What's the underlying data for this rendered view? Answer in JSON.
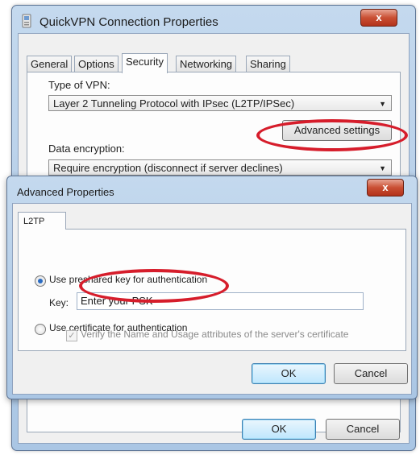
{
  "outer": {
    "title": "QuickVPN Connection Properties",
    "close_glyph": "x",
    "tabs": [
      "General",
      "Options",
      "Security",
      "Networking",
      "Sharing"
    ],
    "active_tab": "Security",
    "type_of_vpn_label": "Type of VPN:",
    "type_of_vpn_value": "Layer 2 Tunneling Protocol with IPsec (L2TP/IPSec)",
    "advanced_settings_label": "Advanced settings",
    "data_encryption_label": "Data encryption:",
    "data_encryption_value": "Require encryption (disconnect if server declines)",
    "ok_label": "OK",
    "cancel_label": "Cancel"
  },
  "inner": {
    "title": "Advanced Properties",
    "close_glyph": "x",
    "tab_label": "L2TP",
    "use_psk_label": "Use preshared key for authentication",
    "use_psk_selected": true,
    "key_label": "Key:",
    "key_value": "Enter your PSK",
    "use_cert_label": "Use certificate for authentication",
    "verify_label": "Verify the Name and Usage attributes of the server's certificate",
    "verify_checked": true,
    "ok_label": "OK",
    "cancel_label": "Cancel"
  },
  "icons": {
    "window_icon": "vpn-connection-icon",
    "dropdown_arrow": "▼",
    "check_glyph": "✓"
  },
  "colors": {
    "highlight_oval": "#d61d2b",
    "close_button": "#c94f33",
    "title_bar": "#aac6e4"
  }
}
